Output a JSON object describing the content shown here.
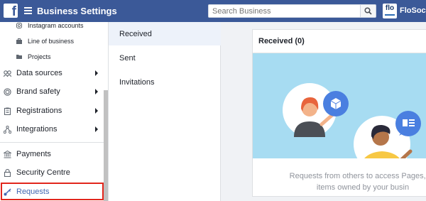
{
  "topbar": {
    "logo_letter": "f",
    "app_title": "Business Settings",
    "search_placeholder": "Search Business",
    "business_logo_text": "flo",
    "business_name": "FloSocial"
  },
  "sidebar": {
    "sub_items": [
      {
        "label": "Instagram accounts",
        "icon": "instagram-icon"
      },
      {
        "label": "Line of business",
        "icon": "briefcase-icon"
      },
      {
        "label": "Projects",
        "icon": "folder-icon"
      }
    ],
    "items": [
      {
        "label": "Data sources",
        "icon": "data-sources-icon",
        "has_arrow": true
      },
      {
        "label": "Brand safety",
        "icon": "shield-icon",
        "has_arrow": true
      },
      {
        "label": "Registrations",
        "icon": "clipboard-icon",
        "has_arrow": true
      },
      {
        "label": "Integrations",
        "icon": "integrations-icon",
        "has_arrow": true
      },
      {
        "label": "Payments",
        "icon": "bank-icon",
        "has_arrow": false
      },
      {
        "label": "Security Centre",
        "icon": "lock-icon",
        "has_arrow": false
      },
      {
        "label": "Requests",
        "icon": "key-icon",
        "has_arrow": false,
        "active": true
      }
    ]
  },
  "middle": {
    "tabs": [
      {
        "label": "Received",
        "active": true
      },
      {
        "label": "Sent",
        "active": false
      },
      {
        "label": "Invitations",
        "active": false
      }
    ]
  },
  "main": {
    "card_title": "Received (0)",
    "description_line1": "Requests from others to access Pages, ac",
    "description_line2": "items owned by your busin"
  },
  "colors": {
    "topbar": "#3b5998",
    "accent": "#4267b2",
    "illustration_bg": "#a7dcf2",
    "highlight": "#e2261c"
  }
}
